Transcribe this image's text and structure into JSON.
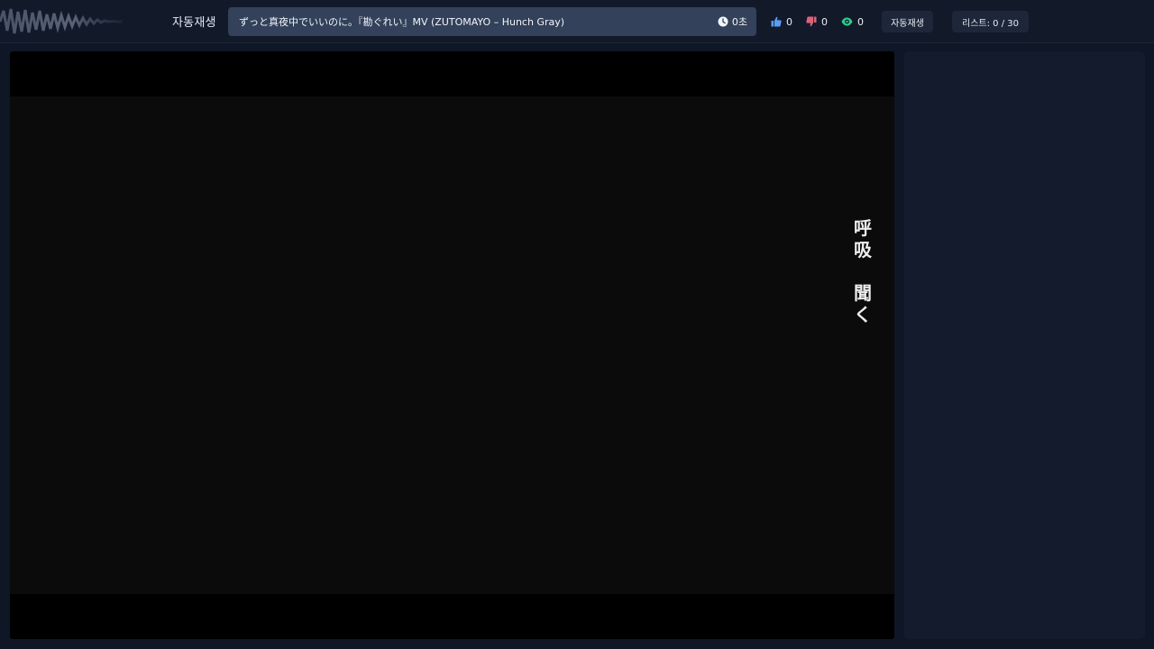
{
  "header": {
    "autoplay_label": "자동재생",
    "now_playing_title": "ずっと真夜中でいいのに。『勘ぐれい』MV (ZUTOMAYO – Hunch Gray)",
    "elapsed": "0초",
    "likes": "0",
    "dislikes": "0",
    "views": "0",
    "autoplay_button": "자동재생",
    "list_counter": "리스트: 0 / 30"
  },
  "video": {
    "overlay_chars": [
      "呼",
      "吸",
      "聞",
      "く"
    ]
  },
  "icons": {
    "logo": "waveform-logo",
    "time": "clock-icon",
    "likes": "thumbs-up-icon",
    "dislikes": "thumbs-down-icon",
    "views": "eye-icon"
  },
  "colors": {
    "background": "#0f1626",
    "title_box": "#33415a",
    "like": "#5b9cf2",
    "dislike": "#e0627a",
    "views": "#2ecc8a"
  }
}
